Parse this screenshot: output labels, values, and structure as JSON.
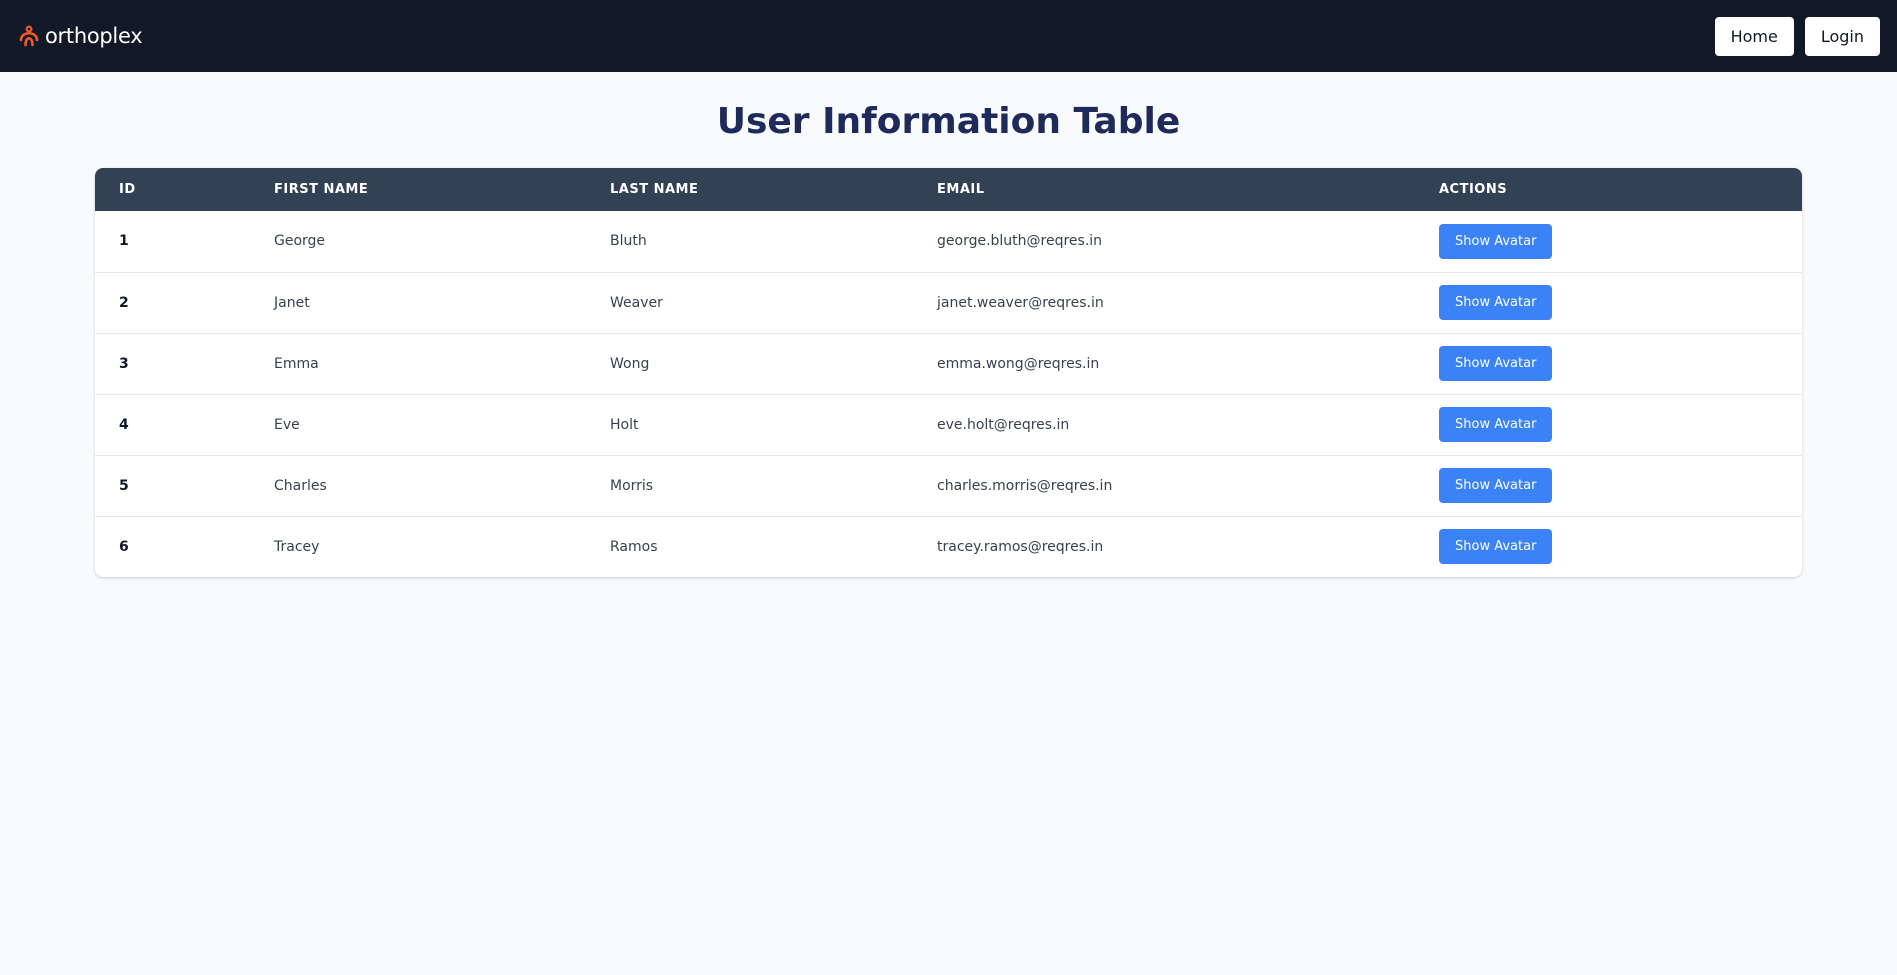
{
  "header": {
    "brand_name": "orthoplex",
    "brand_color": "#f05a28",
    "nav": {
      "home_label": "Home",
      "login_label": "Login"
    }
  },
  "main": {
    "title": "User Information Table",
    "table": {
      "columns": [
        "ID",
        "FIRST NAME",
        "LAST NAME",
        "EMAIL",
        "ACTIONS"
      ],
      "rows": [
        {
          "id": "1",
          "first_name": "George",
          "last_name": "Bluth",
          "email": "george.bluth@reqres.in",
          "action_label": "Show Avatar"
        },
        {
          "id": "2",
          "first_name": "Janet",
          "last_name": "Weaver",
          "email": "janet.weaver@reqres.in",
          "action_label": "Show Avatar"
        },
        {
          "id": "3",
          "first_name": "Emma",
          "last_name": "Wong",
          "email": "emma.wong@reqres.in",
          "action_label": "Show Avatar"
        },
        {
          "id": "4",
          "first_name": "Eve",
          "last_name": "Holt",
          "email": "eve.holt@reqres.in",
          "action_label": "Show Avatar"
        },
        {
          "id": "5",
          "first_name": "Charles",
          "last_name": "Morris",
          "email": "charles.morris@reqres.in",
          "action_label": "Show Avatar"
        },
        {
          "id": "6",
          "first_name": "Tracey",
          "last_name": "Ramos",
          "email": "tracey.ramos@reqres.in",
          "action_label": "Show Avatar"
        }
      ]
    }
  },
  "colors": {
    "navbar_bg": "#111827",
    "title_color": "#1e2a5a",
    "table_header_bg": "#334155",
    "button_bg": "#3b82f6"
  }
}
